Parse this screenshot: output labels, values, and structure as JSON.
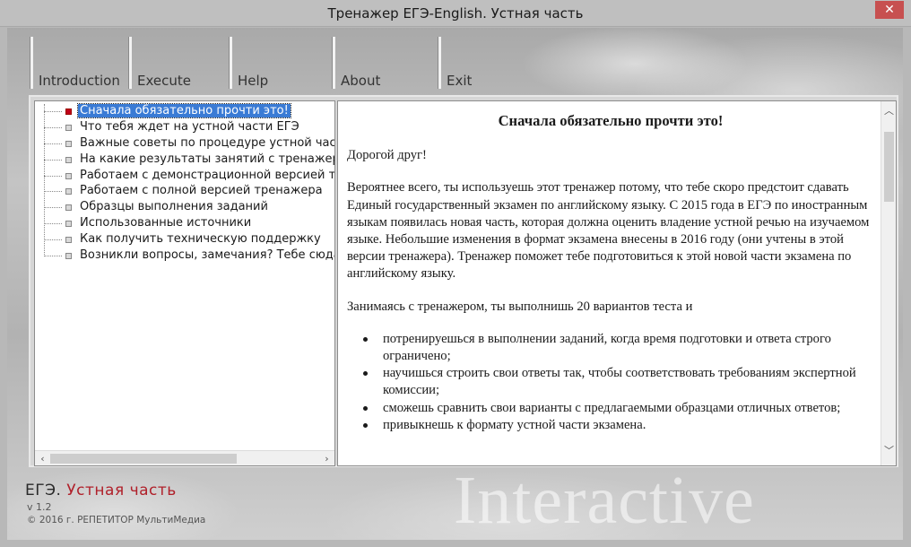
{
  "window": {
    "title": "Тренажер ЕГЭ-English. Устная часть",
    "close_glyph": "✕"
  },
  "toolbar": {
    "buttons": [
      {
        "label": "Introduction",
        "icon": "none"
      },
      {
        "label": "Execute",
        "icon": "none"
      },
      {
        "label": "Help",
        "icon": "none"
      },
      {
        "label": "About",
        "icon": "none"
      },
      {
        "label": "Exit",
        "icon": "none"
      }
    ]
  },
  "tree": {
    "selected_index": 0,
    "items": [
      {
        "label": "Сначала обязательно прочти это!"
      },
      {
        "label": "Что тебя ждет на устной части ЕГЭ"
      },
      {
        "label": "Важные советы по процедуре устной части"
      },
      {
        "label": "На какие результаты занятий с тренажером"
      },
      {
        "label": "Работаем с демонстрационной версией тре"
      },
      {
        "label": "Работаем с полной версией тренажера"
      },
      {
        "label": "Образцы выполнения заданий"
      },
      {
        "label": "Использованные источники"
      },
      {
        "label": "Как получить техническую поддержку"
      },
      {
        "label": "Возникли вопросы, замечания? Тебе сюда!"
      }
    ],
    "scroll_left_glyph": "‹",
    "scroll_right_glyph": "›"
  },
  "content": {
    "heading": "Сначала обязательно прочти это!",
    "greeting": "Дорогой друг!",
    "paragraph1": "Вероятнее всего, ты используешь этот тренажер потому, что тебе скоро предстоит сдавать Единый государственный экзамен по английскому языку. С 2015 года в ЕГЭ по иностранным языкам появилась новая часть, которая должна оценить владение устной речью на изучаемом языке. Небольшие изменения в формат экзамена внесены в 2016 году (они учтены в этой версии тренажера). Тренажер поможет тебе подготовиться к этой новой части экзамена по английскому языку.",
    "paragraph2": "Занимаясь с тренажером, ты выполнишь 20 вариантов теста и",
    "bullets": [
      "потренируешься в выполнении заданий, когда время подготовки и ответа строго ограничено;",
      "научишься строить свои ответы так, чтобы соответствовать требованиям экспертной комиссии;",
      "сможешь сравнить свои варианты с предлагаемыми образцами отличных ответов;",
      "привыкнешь к формату устной части экзамена."
    ],
    "scroll_up_glyph": "︿",
    "scroll_down_glyph": "﹀"
  },
  "footer": {
    "brand_prefix": "ЕГЭ.",
    "brand_accent": "Устная часть",
    "version": "v 1.2",
    "copyright": "© 2016 г. РЕПЕТИТОР МультиМедиа",
    "watermark": "Interactive"
  },
  "colors": {
    "selection": "#3a7bd5",
    "selected_node": "#c0001a",
    "brand_accent": "#b0202a"
  }
}
